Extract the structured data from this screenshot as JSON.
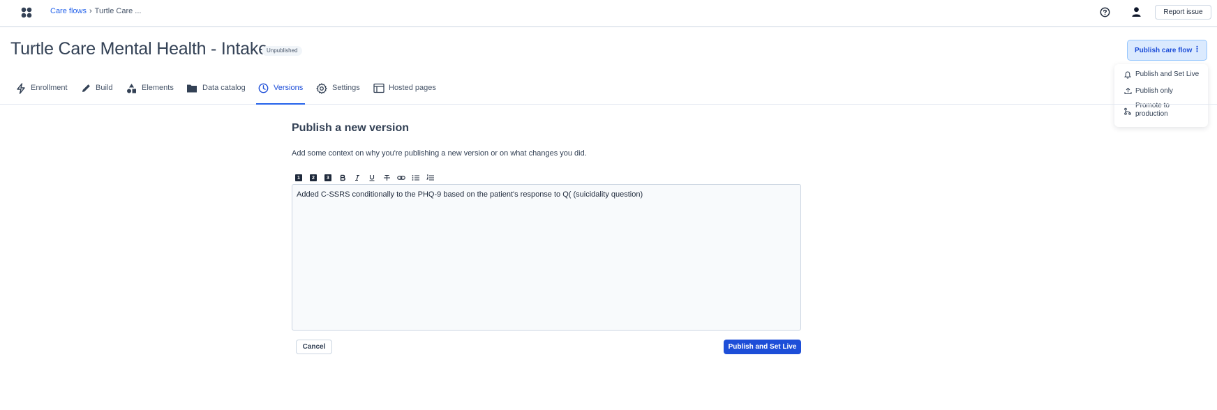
{
  "header": {
    "breadcrumb": {
      "root": "Care flows",
      "separator": "›",
      "current": "Turtle Care ..."
    },
    "report_button": "Report issue"
  },
  "page": {
    "title": "Turtle Care Mental Health - Intake",
    "status": "Unpublished"
  },
  "publish": {
    "button_label": "Publish care flow",
    "more_glyph": "⋮",
    "menu": [
      {
        "label": "Publish and Set Live",
        "icon": "bell-icon"
      },
      {
        "label": "Publish only",
        "icon": "upload-icon"
      },
      {
        "label": "Promote to production",
        "icon": "git-branch-icon"
      }
    ]
  },
  "tabs": [
    {
      "label": "Enrollment",
      "icon": "lightning-icon"
    },
    {
      "label": "Build",
      "icon": "pencil-icon"
    },
    {
      "label": "Elements",
      "icon": "shapes-icon"
    },
    {
      "label": "Data catalog",
      "icon": "folder-icon"
    },
    {
      "label": "Versions",
      "icon": "clock-icon",
      "active": true
    },
    {
      "label": "Settings",
      "icon": "gear-icon"
    },
    {
      "label": "Hosted pages",
      "icon": "browser-window-icon"
    }
  ],
  "form": {
    "title": "Publish a new version",
    "description": "Add some context on why you're publishing a new version or on what changes you did.",
    "toolbar": [
      "1",
      "2",
      "3",
      "bold-icon",
      "italic-icon",
      "underline-icon",
      "strikethrough-icon",
      "link-icon",
      "bullet-list-icon",
      "numbered-list-icon"
    ],
    "editor_value": "Added C-SSRS conditionally to the PHQ-9 based on the patient's response to Q( (suicidality question)",
    "cancel_label": "Cancel",
    "submit_label": "Publish and Set Live"
  },
  "colors": {
    "accent": "#1d4ed8",
    "publish_button_bg": "#dbeafe",
    "text": "#334155"
  }
}
